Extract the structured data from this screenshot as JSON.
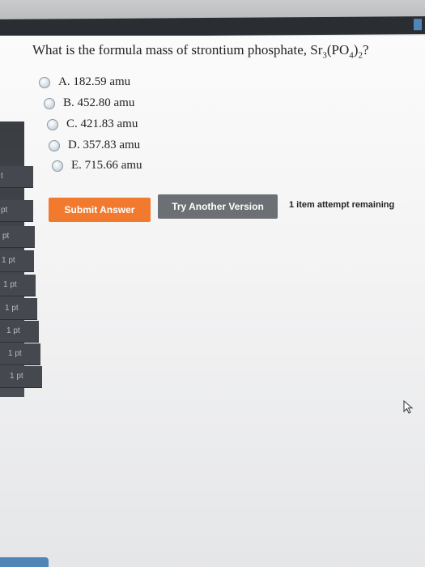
{
  "question": {
    "prefix": "What is the formula mass of strontium phosphate, Sr",
    "sub1": "3",
    "mid": "(PO",
    "sub2": "4",
    "mid2": ")",
    "sub3": "2",
    "suffix": "?"
  },
  "choices": [
    "A. 182.59 amu",
    "B. 452.80 amu",
    "C. 421.83 amu",
    "D. 357.83 amu",
    "E. 715.66 amu"
  ],
  "buttons": {
    "submit": "Submit Answer",
    "try_another": "Try Another Version"
  },
  "attempt_text": "1 item attempt remaining",
  "sidebar": {
    "items": [
      "t",
      "pt",
      "pt",
      "1 pt",
      "1 pt",
      "1 pt",
      "1 pt",
      "1 pt",
      "1 pt"
    ]
  },
  "colors": {
    "submit_bg": "#f27a2e",
    "try_bg": "#6c6f73",
    "sidebar_bg": "#3a3d42",
    "top_bar": "#2a2d31",
    "accent_blue": "#4f86b6"
  }
}
